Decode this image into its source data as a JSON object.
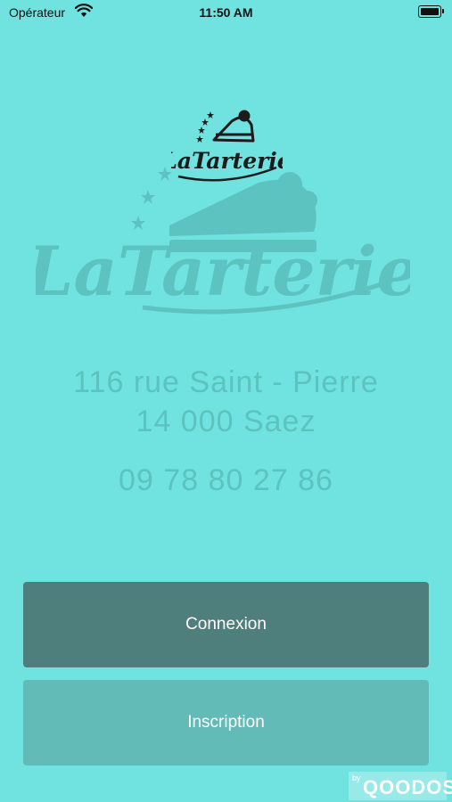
{
  "status_bar": {
    "carrier": "Opérateur",
    "time": "11:50 AM"
  },
  "logo": {
    "small_text": "LaTarterie",
    "big_text": "LaTarterie"
  },
  "address": {
    "line1": "116 rue Saint -  Pierre",
    "line2": "14 000 Saez"
  },
  "phone": "09 78 80 27 86",
  "buttons": {
    "login": "Connexion",
    "signup": "Inscription"
  },
  "watermark": {
    "by": "by",
    "brand": "QOODOS"
  },
  "colors": {
    "background": "#70e2df",
    "login": "#4f7f7c",
    "signup": "#63bbb8",
    "faded": "#5cc3c0"
  }
}
